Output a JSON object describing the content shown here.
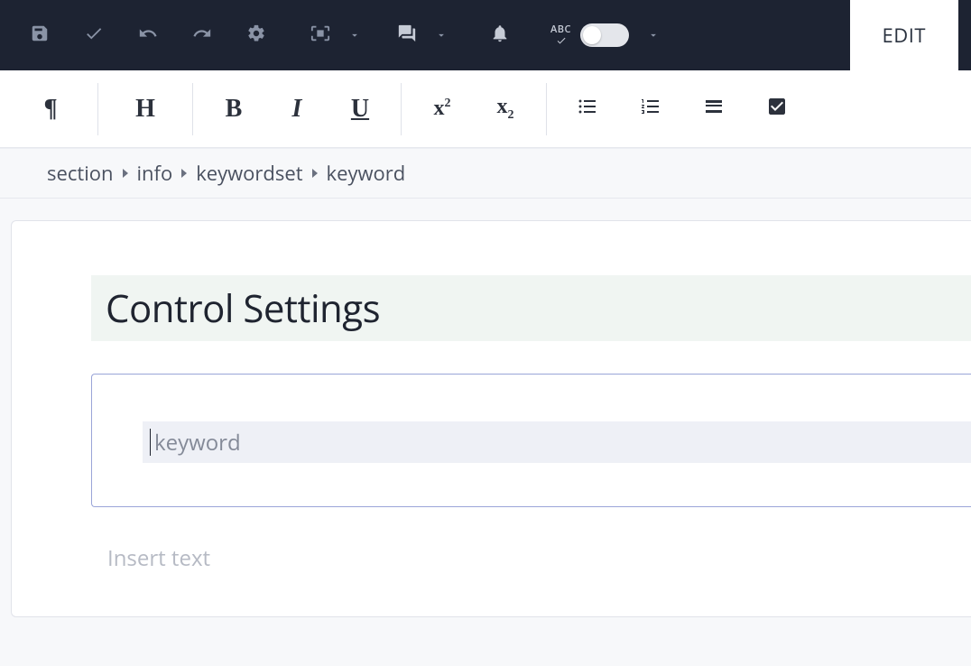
{
  "topbar": {
    "icons": {
      "save": "save-icon",
      "check": "check-icon",
      "undo": "undo-icon",
      "redo": "redo-icon",
      "settings": "gear-icon",
      "frame": "frame-icon",
      "comments": "comments-icon",
      "bell": "bell-icon",
      "spellcheck_label": "ABC"
    },
    "edit_tab_label": "EDIT",
    "spellcheck_enabled": false
  },
  "format_bar": {
    "paragraph": "¶",
    "heading": "H",
    "bold": "B",
    "italic": "I",
    "underline": "U",
    "superscript_base": "x",
    "superscript_exp": "2",
    "subscript_base": "x",
    "subscript_exp": "2"
  },
  "breadcrumb": {
    "items": [
      "section",
      "info",
      "keywordset",
      "keyword"
    ]
  },
  "document": {
    "title": "Control Settings",
    "keyword_field": {
      "placeholder": "keyword",
      "value": ""
    },
    "body_placeholder": "Insert text"
  }
}
